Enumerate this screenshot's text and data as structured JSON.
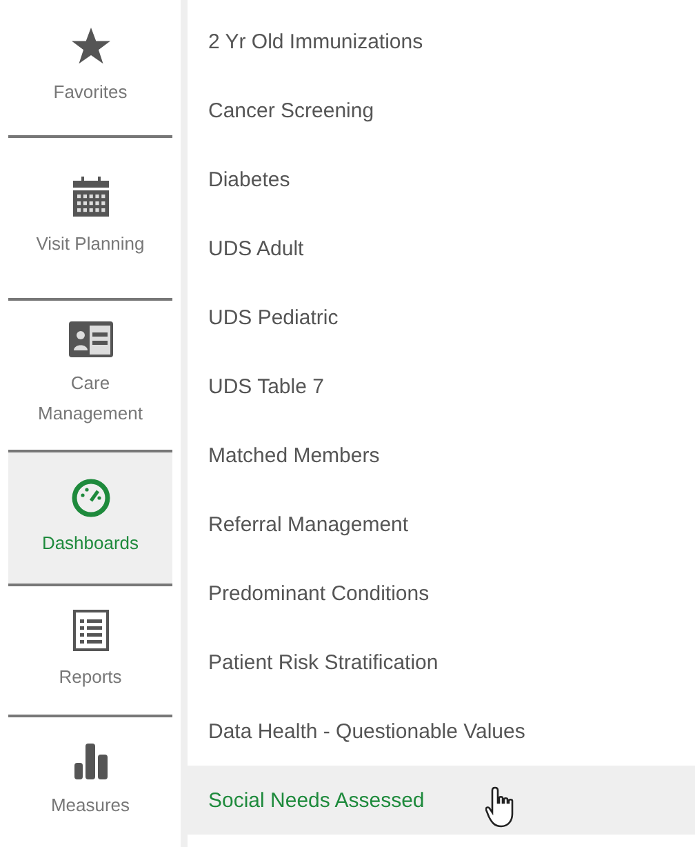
{
  "sidebar": {
    "items": [
      {
        "kind": "star",
        "label": "Favorites",
        "selected": false
      },
      {
        "kind": "calendar",
        "label": "Visit Planning",
        "selected": false
      },
      {
        "kind": "card",
        "label": "Care Management",
        "selected": false
      },
      {
        "kind": "gauge",
        "label": "Dashboards",
        "selected": true
      },
      {
        "kind": "list",
        "label": "Reports",
        "selected": false
      },
      {
        "kind": "bars",
        "label": "Measures",
        "selected": false
      }
    ]
  },
  "menu": {
    "items": [
      {
        "label": "2 Yr Old Immunizations",
        "selected": false
      },
      {
        "label": "Cancer Screening",
        "selected": false
      },
      {
        "label": "Diabetes",
        "selected": false
      },
      {
        "label": "UDS Adult",
        "selected": false
      },
      {
        "label": "UDS Pediatric",
        "selected": false
      },
      {
        "label": "UDS Table 7",
        "selected": false
      },
      {
        "label": "Matched Members",
        "selected": false
      },
      {
        "label": "Referral Management",
        "selected": false
      },
      {
        "label": "Predominant Conditions",
        "selected": false
      },
      {
        "label": "Patient Risk Stratification",
        "selected": false
      },
      {
        "label": "Data Health - Questionable Values",
        "selected": false
      },
      {
        "label": "Social Needs Assessed",
        "selected": true
      }
    ]
  }
}
